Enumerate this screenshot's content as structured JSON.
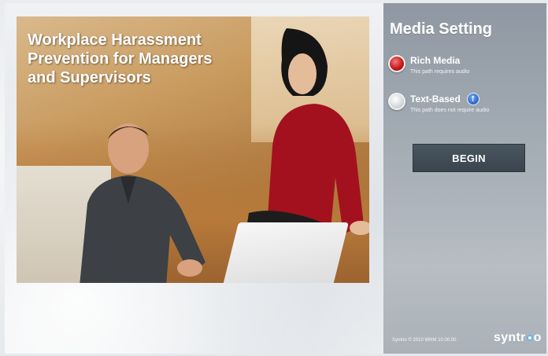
{
  "hero": {
    "title": "Workplace Harassment\nPrevention for Managers\nand Supervisors"
  },
  "panel": {
    "title": "Media Setting",
    "options": [
      {
        "label": "Rich Media",
        "description": "This path requires audio",
        "selected": true,
        "color": "#c91a1a"
      },
      {
        "label": "Text-Based",
        "description": "This path does not require audio",
        "selected": false,
        "info_icon": "info-icon"
      }
    ],
    "begin_label": "BEGIN",
    "copyright": "Syntrio © 2010 WHM 10.00.00",
    "logo": {
      "before": "syntr",
      "after": "o"
    }
  },
  "colors": {
    "panel_bg": "#a6aeb6",
    "button_bg": "#3f4a54",
    "accent_blue": "#2b66c8"
  }
}
